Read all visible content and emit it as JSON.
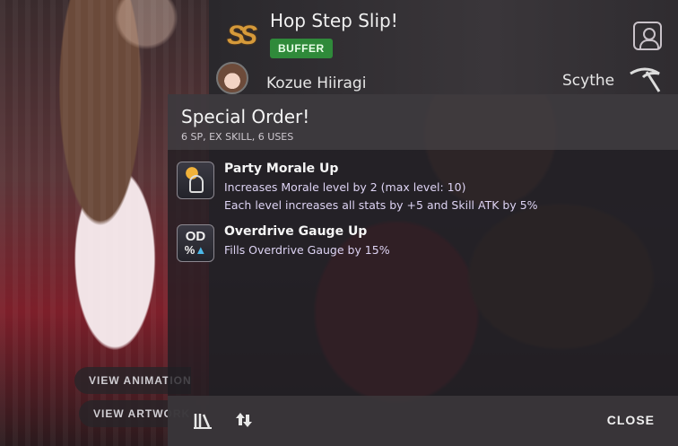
{
  "left_card": {
    "view_animation_label": "VIEW ANIMATION",
    "view_artwork_label": "VIEW ARTWORK"
  },
  "skill_header": {
    "rank": "SS",
    "skill_name": "Hop Step Slip!",
    "role_tag": "BUFFER",
    "character_name": "Kozue Hiiragi",
    "weapon": "Scythe",
    "icons": {
      "profile": "character-profile-icon",
      "weapon": "scythe-icon"
    }
  },
  "special_order": {
    "title": "Special Order!",
    "subtitle": "6 SP, EX SKILL, 6 USES",
    "effects": [
      {
        "icon": "morale-up-icon",
        "name": "Party Morale Up",
        "lines": [
          "Increases Morale level by 2 (max level: 10)",
          "Each level increases all stats by +5 and Skill ATK by 5%"
        ]
      },
      {
        "icon": "overdrive-gauge-icon",
        "icon_text_top": "OD",
        "icon_text_bottom": "%",
        "name": "Overdrive Gauge Up",
        "lines": [
          "Fills Overdrive Gauge by 15%"
        ]
      }
    ]
  },
  "footer": {
    "library_icon": "library-icon",
    "swap_icon": "swap-icon",
    "close_label": "CLOSE"
  },
  "colors": {
    "role_tag_bg": "#2f8a3a",
    "rank_gold": "#d69a3a",
    "effect_text": "#ded4f4",
    "od_arrow": "#4bb8e8"
  }
}
